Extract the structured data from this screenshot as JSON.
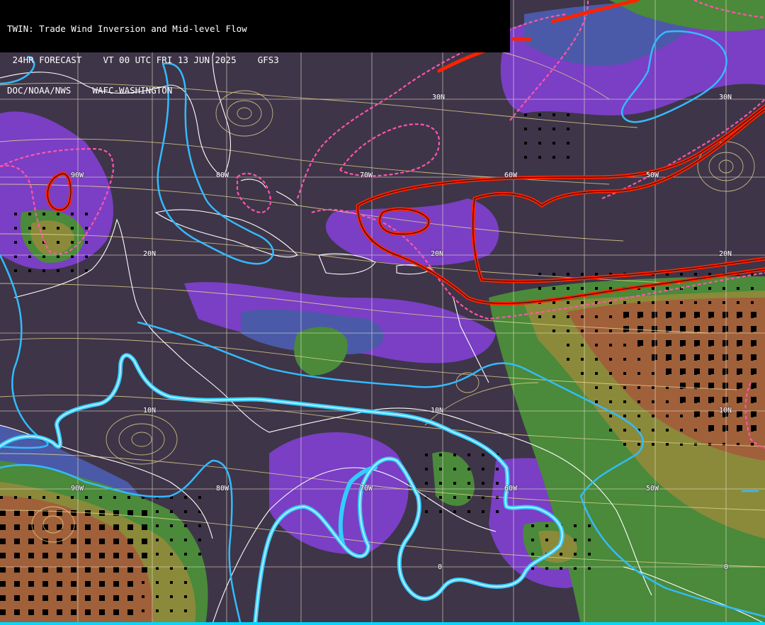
{
  "header": {
    "line1": "TWIN: Trade Wind Inversion and Mid-level Flow",
    "line2": " 24HR FORECAST    VT 00 UTC FRI 13 JUN 2025    GFS3",
    "line3": "DOC/NOAA/NWS    WAFC-WASHINGTON"
  },
  "grid_labels": {
    "lat_30n_a": "30N",
    "lat_30n_b": "30N",
    "lat_20n_a": "20N",
    "lat_20n_b": "20N",
    "lat_20n_c": "20N",
    "lat_10n_a": "10N",
    "lat_10n_b": "10N",
    "lat_10n_c": "10N",
    "lat_0_a": "0",
    "lat_0_b": "0",
    "lon_90w_a": "90W",
    "lon_80w_a": "80W",
    "lon_70w_a": "70W",
    "lon_60w_a": "60W",
    "lon_50w_a": "50W",
    "lon_90w_b": "90W",
    "lon_80w_b": "80W",
    "lon_70w_b": "70W",
    "lon_60w_b": "60W",
    "lon_50w_b": "50W"
  },
  "colors": {
    "background": "#3e3548",
    "purple": "#7a3fc4",
    "blue": "#4a5aa8",
    "green": "#4a8a3a",
    "olive": "#8a8a3a",
    "brown": "#a0603a",
    "cyan_contour": "#33bbff",
    "red_contour": "#ff2200",
    "magenta_dashed": "#ff55aa",
    "streamline": "#e8d890",
    "coast": "#ffffff"
  }
}
